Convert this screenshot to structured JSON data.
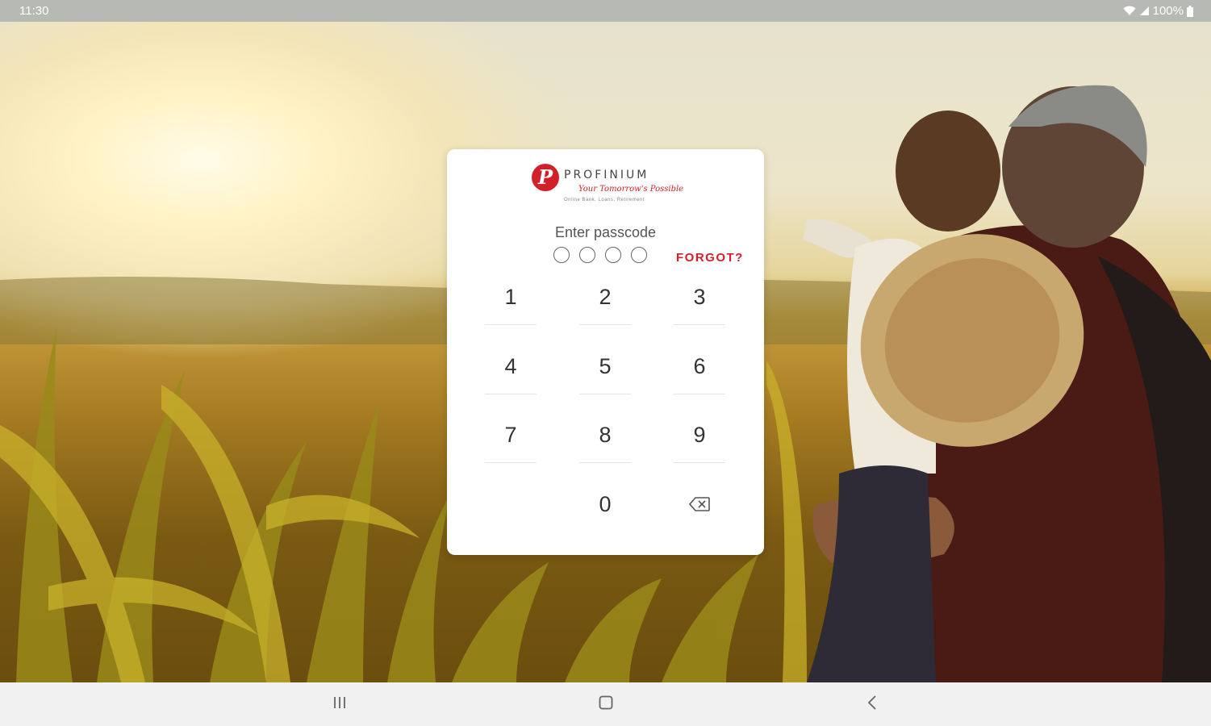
{
  "status_bar": {
    "time": "11:30",
    "battery": "100%"
  },
  "brand": {
    "mark": "P",
    "name": "PROFINIUM",
    "tagline": "Your Tomorrow's Possible",
    "subtitle": "Online Bank. Loans. Retirement"
  },
  "passcode": {
    "prompt": "Enter passcode",
    "digits_entered": 0,
    "length": 4,
    "forgot_label": "FORGOT?"
  },
  "keypad": {
    "k1": "1",
    "k2": "2",
    "k3": "3",
    "k4": "4",
    "k5": "5",
    "k6": "6",
    "k7": "7",
    "k8": "8",
    "k9": "9",
    "k0": "0"
  },
  "icons": {
    "backspace": "backspace-icon",
    "wifi": "wifi-icon",
    "signal": "signal-icon",
    "battery": "battery-icon",
    "recents": "recents-icon",
    "home": "home-icon",
    "back": "back-icon"
  },
  "colors": {
    "brand_red": "#d1202a",
    "card_bg": "#ffffff"
  }
}
